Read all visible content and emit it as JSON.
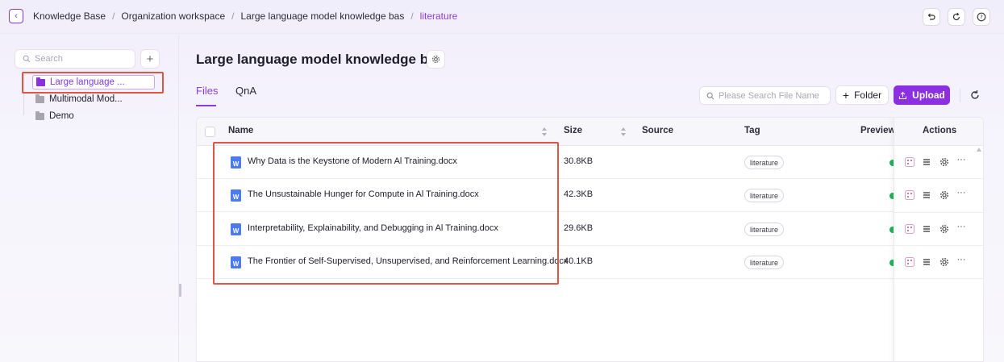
{
  "breadcrumb": {
    "items": [
      "Knowledge Base",
      "Organization workspace",
      "Large language model knowledge bas"
    ],
    "current": "literature"
  },
  "sidebar": {
    "search_placeholder": "Search",
    "items": [
      {
        "label": "Large language ...",
        "active": true
      },
      {
        "label": "Multimodal Mod..."
      },
      {
        "label": "Demo"
      }
    ]
  },
  "main": {
    "title": "Large language model knowledge bas",
    "tabs": [
      {
        "label": "Files",
        "active": true
      },
      {
        "label": "QnA"
      }
    ],
    "file_search_placeholder": "Please Search File Name",
    "folder_label": "Folder",
    "upload_label": "Upload"
  },
  "table": {
    "columns": [
      "Name",
      "Size",
      "Source",
      "Tag",
      "Preview S",
      "Actions"
    ],
    "rows": [
      {
        "name": "Why Data is the Keystone of Modern Al Training.docx",
        "size": "30.8KB",
        "source": "",
        "tag": "literature"
      },
      {
        "name": "The Unsustainable Hunger for Compute in Al Training.docx",
        "size": "42.3KB",
        "source": "",
        "tag": "literature"
      },
      {
        "name": "Interpretability, Explainability, and Debugging in Al Training.docx",
        "size": "29.6KB",
        "source": "",
        "tag": "literature"
      },
      {
        "name": "The Frontier of Self-Supervised, Unsupervised, and Reinforcement Learning.docx",
        "size": "40.1KB",
        "source": "",
        "tag": "literature"
      }
    ]
  },
  "colors": {
    "accent": "#8b2fe0",
    "highlight_box": "#e05543",
    "doc_icon": "#4b7bef",
    "status_green": "#23b25b"
  },
  "icons": [
    "back-icon",
    "undo-icon",
    "sync-icon",
    "help-icon",
    "search-icon",
    "plus-icon",
    "folder-icon",
    "gear-icon",
    "upload-icon",
    "refresh-icon",
    "word-doc-icon",
    "qr-icon",
    "list-icon",
    "more-icon"
  ]
}
